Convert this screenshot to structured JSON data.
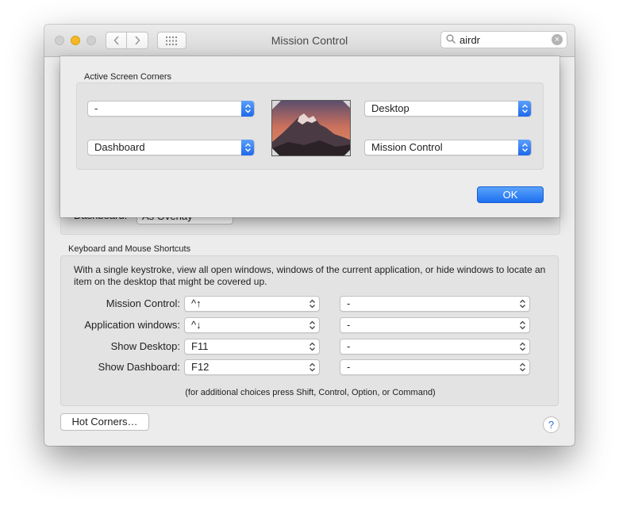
{
  "window": {
    "title": "Mission Control",
    "search_value": "airdr"
  },
  "background": {
    "dashboard_label": "Dashboard:",
    "dashboard_value": "As Overlay"
  },
  "shortcuts": {
    "section_label": "Keyboard and Mouse Shortcuts",
    "description": "With a single keystroke, view all open windows, windows of the current application, or hide windows to locate an item on the desktop that might be covered up.",
    "rows": [
      {
        "label": "Mission Control:",
        "key": "^↑",
        "mouse": "-"
      },
      {
        "label": "Application windows:",
        "key": "^↓",
        "mouse": "-"
      },
      {
        "label": "Show Desktop:",
        "key": "F11",
        "mouse": "-"
      },
      {
        "label": "Show Dashboard:",
        "key": "F12",
        "mouse": "-"
      }
    ],
    "note": "(for additional choices press Shift, Control, Option, or Command)"
  },
  "buttons": {
    "hot_corners": "Hot Corners…",
    "help": "?",
    "ok": "OK"
  },
  "sheet": {
    "label": "Active Screen Corners",
    "top_left": "-",
    "bottom_left": "Dashboard",
    "top_right": "Desktop",
    "bottom_right": "Mission Control"
  },
  "colors": {
    "accent": "#1f6ff0",
    "window_bg": "#ececec",
    "group_bg": "#e3e3e3"
  }
}
